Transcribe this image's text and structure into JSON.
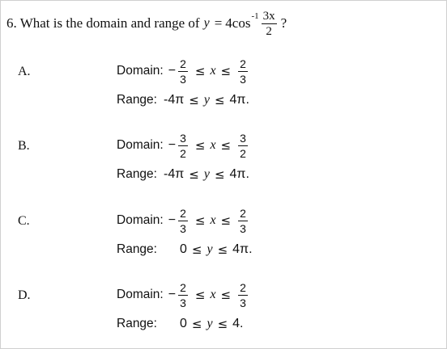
{
  "question": {
    "text": "6. What is the domain and range of",
    "y_var": "y",
    "equals": "=",
    "func": "4cos",
    "sup": "-1",
    "frac_num": "3x",
    "frac_den": "2",
    "qmark": "?"
  },
  "options": [
    {
      "letter": "A.",
      "domain_label": "Domain:",
      "neg": "−",
      "low_num": "2",
      "low_den": "3",
      "le1": "≤",
      "x": "x",
      "le2": "≤",
      "high_num": "2",
      "high_den": "3",
      "range_label": "Range:",
      "range_low": "-4π",
      "le3": "≤",
      "y": "y",
      "le4": "≤",
      "range_high": "4π."
    },
    {
      "letter": "B.",
      "domain_label": "Domain:",
      "neg": "−",
      "low_num": "3",
      "low_den": "2",
      "le1": "≤",
      "x": "x",
      "le2": "≤",
      "high_num": "3",
      "high_den": "2",
      "range_label": "Range:",
      "range_low": "-4π",
      "le3": "≤",
      "y": "y",
      "le4": "≤",
      "range_high": "4π."
    },
    {
      "letter": "C.",
      "domain_label": "Domain:",
      "neg": "−",
      "low_num": "2",
      "low_den": "3",
      "le1": "≤",
      "x": "x",
      "le2": "≤",
      "high_num": "2",
      "high_den": "3",
      "range_label": "Range:",
      "range_low": "0",
      "le3": "≤",
      "y": "y",
      "le4": "≤",
      "range_high": "4π."
    },
    {
      "letter": "D.",
      "domain_label": "Domain:",
      "neg": "−",
      "low_num": "2",
      "low_den": "3",
      "le1": "≤",
      "x": "x",
      "le2": "≤",
      "high_num": "2",
      "high_den": "3",
      "range_label": "Range:",
      "range_low": "0",
      "le3": "≤",
      "y": "y",
      "le4": "≤",
      "range_high": "4."
    }
  ]
}
